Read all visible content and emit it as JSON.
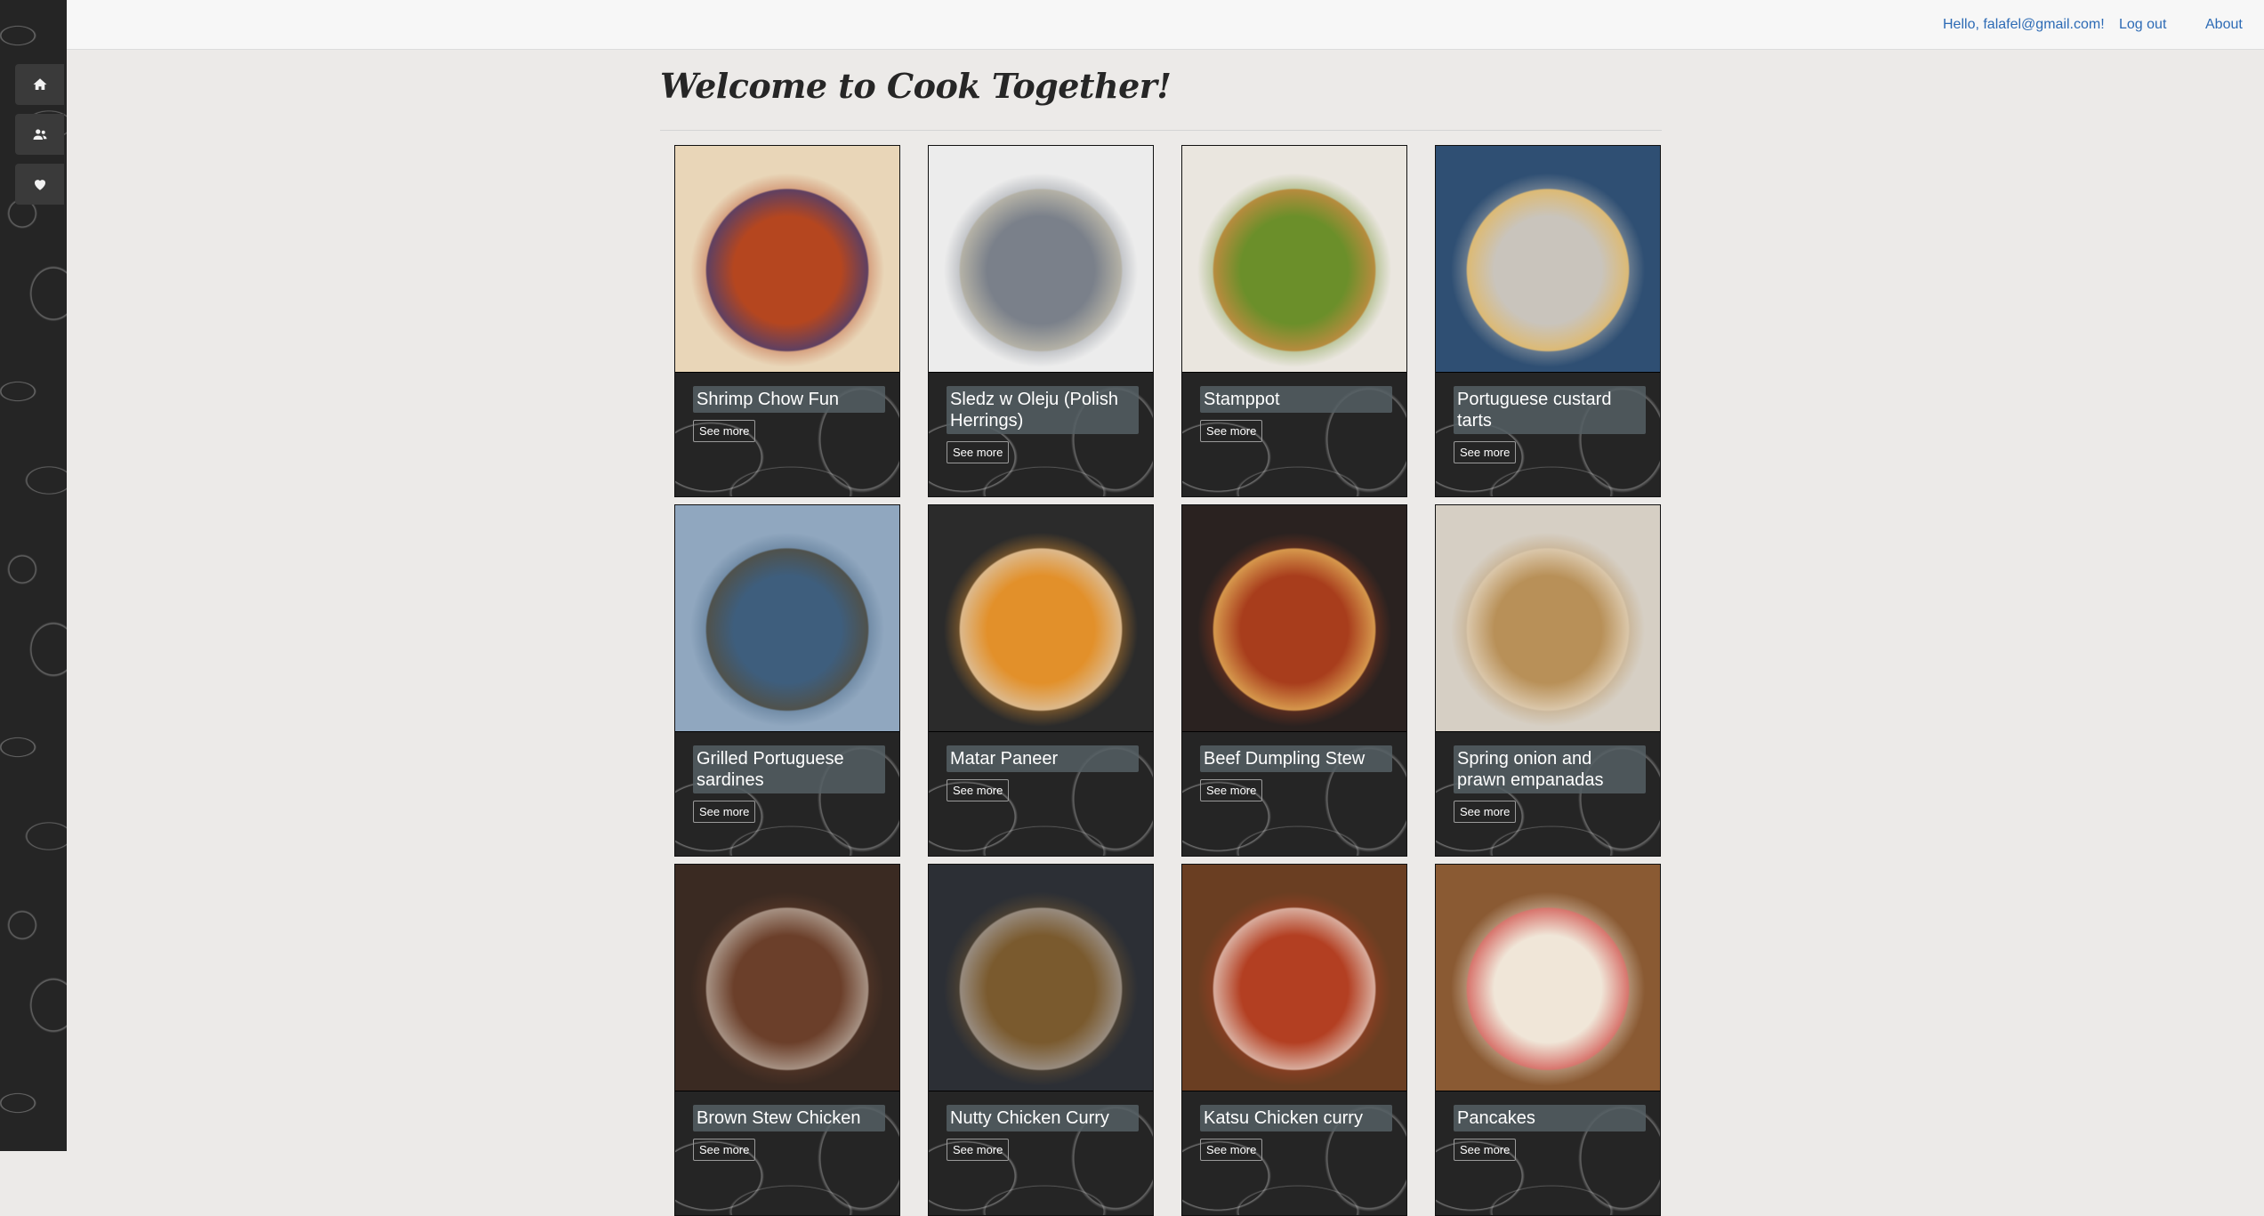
{
  "nav": {
    "hello": "Hello, falafel@gmail.com!",
    "logout": "Log out",
    "about": "About"
  },
  "sidebar": {
    "items": [
      {
        "icon": "home-icon"
      },
      {
        "icon": "users-icon"
      },
      {
        "icon": "heart-icon"
      }
    ]
  },
  "page": {
    "title": "Welcome to Cook Together!"
  },
  "recipes": [
    {
      "name": "Shrimp Chow Fun",
      "button": "See more",
      "img_colors": [
        "#e9d6b8",
        "#b5461f",
        "#2a3c8a"
      ]
    },
    {
      "name": "Sledz w Oleju (Polish Herrings)",
      "button": "See more",
      "img_colors": [
        "#ececec",
        "#7a808a",
        "#d8d0b8"
      ]
    },
    {
      "name": "Stamppot",
      "button": "See more",
      "img_colors": [
        "#eae6df",
        "#6b8f2a",
        "#e58a4a"
      ]
    },
    {
      "name": "Portuguese custard tarts",
      "button": "See more",
      "img_colors": [
        "#2f4f73",
        "#c9c4bc",
        "#e8b44a"
      ]
    },
    {
      "name": "Grilled Portuguese sardines",
      "button": "See more",
      "img_colors": [
        "#90a7bf",
        "#3e5e7d",
        "#5a4a2e"
      ]
    },
    {
      "name": "Matar Paneer",
      "button": "See more",
      "img_colors": [
        "#2b2b2b",
        "#e2902a",
        "#d9d2c8"
      ]
    },
    {
      "name": "Beef Dumpling Stew",
      "button": "See more",
      "img_colors": [
        "#2a2220",
        "#a83d1c",
        "#f2cf6a"
      ]
    },
    {
      "name": "Spring onion and prawn empanadas",
      "button": "See more",
      "img_colors": [
        "#d6cfc4",
        "#b89058",
        "#efe8dc"
      ]
    },
    {
      "name": "Brown Stew Chicken",
      "button": "See more",
      "img_colors": [
        "#3a2a22",
        "#6b3f2a",
        "#c9c2b8"
      ]
    },
    {
      "name": "Nutty Chicken Curry",
      "button": "See more",
      "img_colors": [
        "#2c2f35",
        "#7a5a2e",
        "#a9a9b0"
      ]
    },
    {
      "name": "Katsu Chicken curry",
      "button": "See more",
      "img_colors": [
        "#6a3e22",
        "#b33f22",
        "#efefe8"
      ]
    },
    {
      "name": "Pancakes",
      "button": "See more",
      "img_colors": [
        "#8a5a33",
        "#f0e6d8",
        "#c9302c"
      ]
    }
  ]
}
